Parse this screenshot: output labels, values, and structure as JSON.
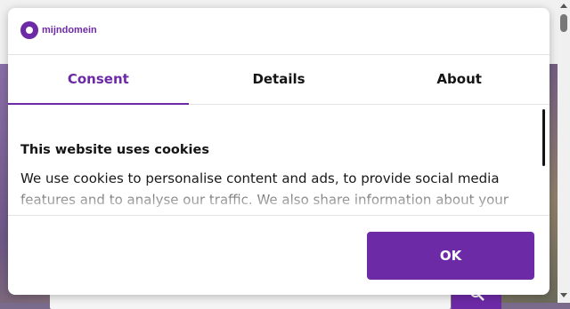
{
  "brand": {
    "logo_text": "mijndomein",
    "accent_color": "#6d2aa6"
  },
  "tabs": [
    {
      "label": "Consent",
      "active": true
    },
    {
      "label": "Details",
      "active": false
    },
    {
      "label": "About",
      "active": false
    }
  ],
  "content": {
    "title": "This website uses cookies",
    "body": "We use cookies to personalise content and ads, to provide social media features and to analyse our traffic. We also share information about your"
  },
  "actions": {
    "ok_label": "OK"
  },
  "icons": {
    "search": "search-icon",
    "logo": "logo-icon"
  }
}
